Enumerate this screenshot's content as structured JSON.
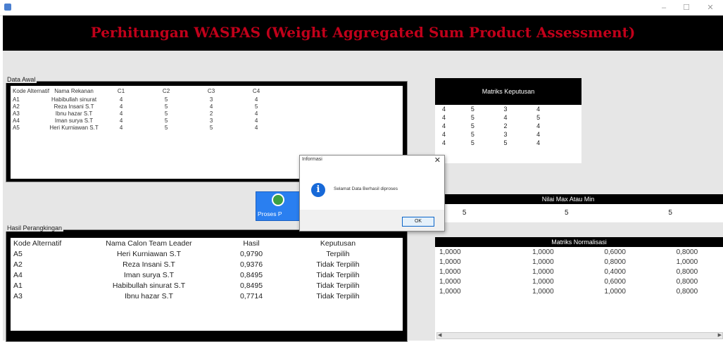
{
  "header": {
    "title": "Perhitungan WASPAS (Weight Aggregated Sum Product Assessment)"
  },
  "data_awal": {
    "label": "Data Awal",
    "columns": [
      "Kode Alternatif",
      "Nama Rekanan",
      "C1",
      "C2",
      "C3",
      "C4"
    ],
    "rows": [
      [
        "A1",
        "Habibullah sinurat",
        "4",
        "5",
        "3",
        "4"
      ],
      [
        "A2",
        "Reza Insani S.T",
        "4",
        "5",
        "4",
        "5"
      ],
      [
        "A3",
        "Ibnu hazar S.T",
        "4",
        "5",
        "2",
        "4"
      ],
      [
        "A4",
        "Iman surya S.T",
        "4",
        "5",
        "3",
        "4"
      ],
      [
        "A5",
        "Heri Kurniawan S.T",
        "4",
        "5",
        "5",
        "4"
      ]
    ]
  },
  "matriks_keputusan": {
    "title": "Matriks Keputusan",
    "rows": [
      [
        "4",
        "5",
        "3",
        "4"
      ],
      [
        "4",
        "5",
        "4",
        "5"
      ],
      [
        "4",
        "5",
        "2",
        "4"
      ],
      [
        "4",
        "5",
        "3",
        "4"
      ],
      [
        "4",
        "5",
        "5",
        "4"
      ]
    ]
  },
  "proses_button": {
    "label": "Proses P"
  },
  "dialog": {
    "title": "Informasi",
    "message": "Selamat Data Berhasil diproses",
    "ok": "OK",
    "close": "✕",
    "icon": "i"
  },
  "nilai_max_min": {
    "title": "Nilai Max Atau Min",
    "values": [
      "5",
      "5",
      "5"
    ]
  },
  "hasil_perangkingan": {
    "label": "Hasil Perangkingan",
    "columns": [
      "Kode Alternatif",
      "Nama Calon Team Leader",
      "Hasil",
      "Keputusan"
    ],
    "rows": [
      [
        "A5",
        "Heri Kurniawan S.T",
        "0,9790",
        "Terpilih"
      ],
      [
        "A2",
        "Reza Insani S.T",
        "0,9376",
        "Tidak Terpilih"
      ],
      [
        "A4",
        "Iman surya S.T",
        "0,8495",
        "Tidak Terpilih"
      ],
      [
        "A1",
        "Habibullah sinurat S.T",
        "0,8495",
        "Tidak Terpilih"
      ],
      [
        "A3",
        "Ibnu hazar S.T",
        "0,7714",
        "Tidak Terpilih"
      ]
    ]
  },
  "matriks_normalisasi": {
    "title": "Matriks Normalisasi",
    "rows": [
      [
        "1,0000",
        "1,0000",
        "0,6000",
        "0,8000"
      ],
      [
        "1,0000",
        "1,0000",
        "0,8000",
        "1,0000"
      ],
      [
        "1,0000",
        "1,0000",
        "0,4000",
        "0,8000"
      ],
      [
        "1,0000",
        "1,0000",
        "0,6000",
        "0,8000"
      ],
      [
        "1,0000",
        "1,0000",
        "1,0000",
        "0,8000"
      ]
    ]
  },
  "icons": {
    "minimize": "–",
    "maximize": "☐",
    "close": "✕",
    "scroll_left": "◀",
    "scroll_right": "▶"
  }
}
